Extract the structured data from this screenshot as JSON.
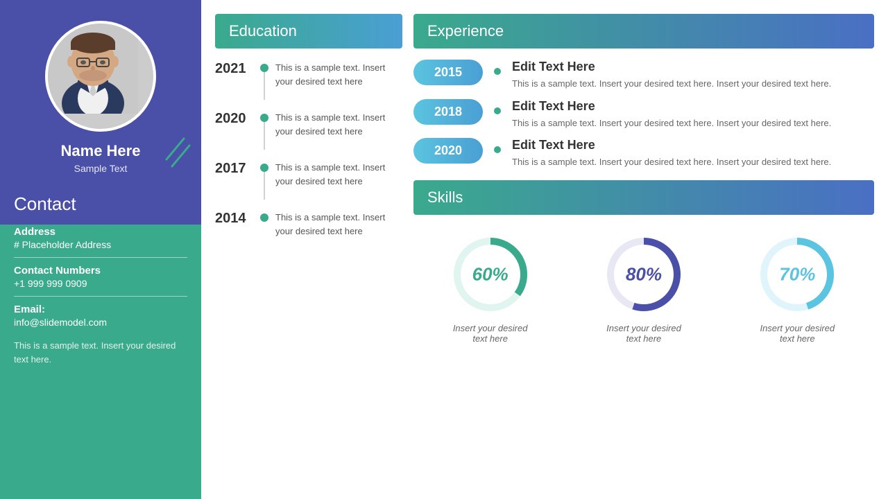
{
  "sidebar": {
    "name": "Name Here",
    "subtitle": "Sample Text",
    "contact_title": "Contact",
    "address_label": "Address",
    "address_value": "# Placeholder Address",
    "phone_label": "Contact Numbers",
    "phone_value": "+1 999 999 0909",
    "email_label": "Email:",
    "email_value": "info@slidemodel.com",
    "footer_text": "This is a sample text. Insert your desired text here."
  },
  "education": {
    "header": "Education",
    "items": [
      {
        "year": "2021",
        "text": "This is a sample text. Insert your desired text here"
      },
      {
        "year": "2020",
        "text": "This is a sample text. Insert your desired text here"
      },
      {
        "year": "2017",
        "text": "This is a sample text. Insert your desired text here"
      },
      {
        "year": "2014",
        "text": "This is a sample text. Insert your desired text here"
      }
    ]
  },
  "experience": {
    "header": "Experience",
    "items": [
      {
        "year": "2015",
        "title": "Edit Text Here",
        "text": "This is a sample text. Insert your desired text here. Insert your desired text here."
      },
      {
        "year": "2018",
        "title": "Edit Text Here",
        "text": "This is a sample text. Insert your desired text here. Insert your desired text here."
      },
      {
        "year": "2020",
        "title": "Edit Text Here",
        "text": "This is a sample text. Insert your desired text here. Insert your desired text here."
      }
    ]
  },
  "skills": {
    "header": "Skills",
    "items": [
      {
        "percent": "60%",
        "label": "Insert your desired\ntext here",
        "color": "#3aaa8c",
        "track": "#e0f5ef"
      },
      {
        "percent": "80%",
        "label": "Insert your desired\ntext here",
        "color": "#4a4fa8",
        "track": "#e8e8f5"
      },
      {
        "percent": "70%",
        "label": "Insert your desired\ntext here",
        "color": "#5bc4e0",
        "track": "#e0f5fb"
      }
    ]
  },
  "colors": {
    "green": "#3aaa8c",
    "purple": "#4a4fa8",
    "light_blue": "#5bc4e0"
  }
}
